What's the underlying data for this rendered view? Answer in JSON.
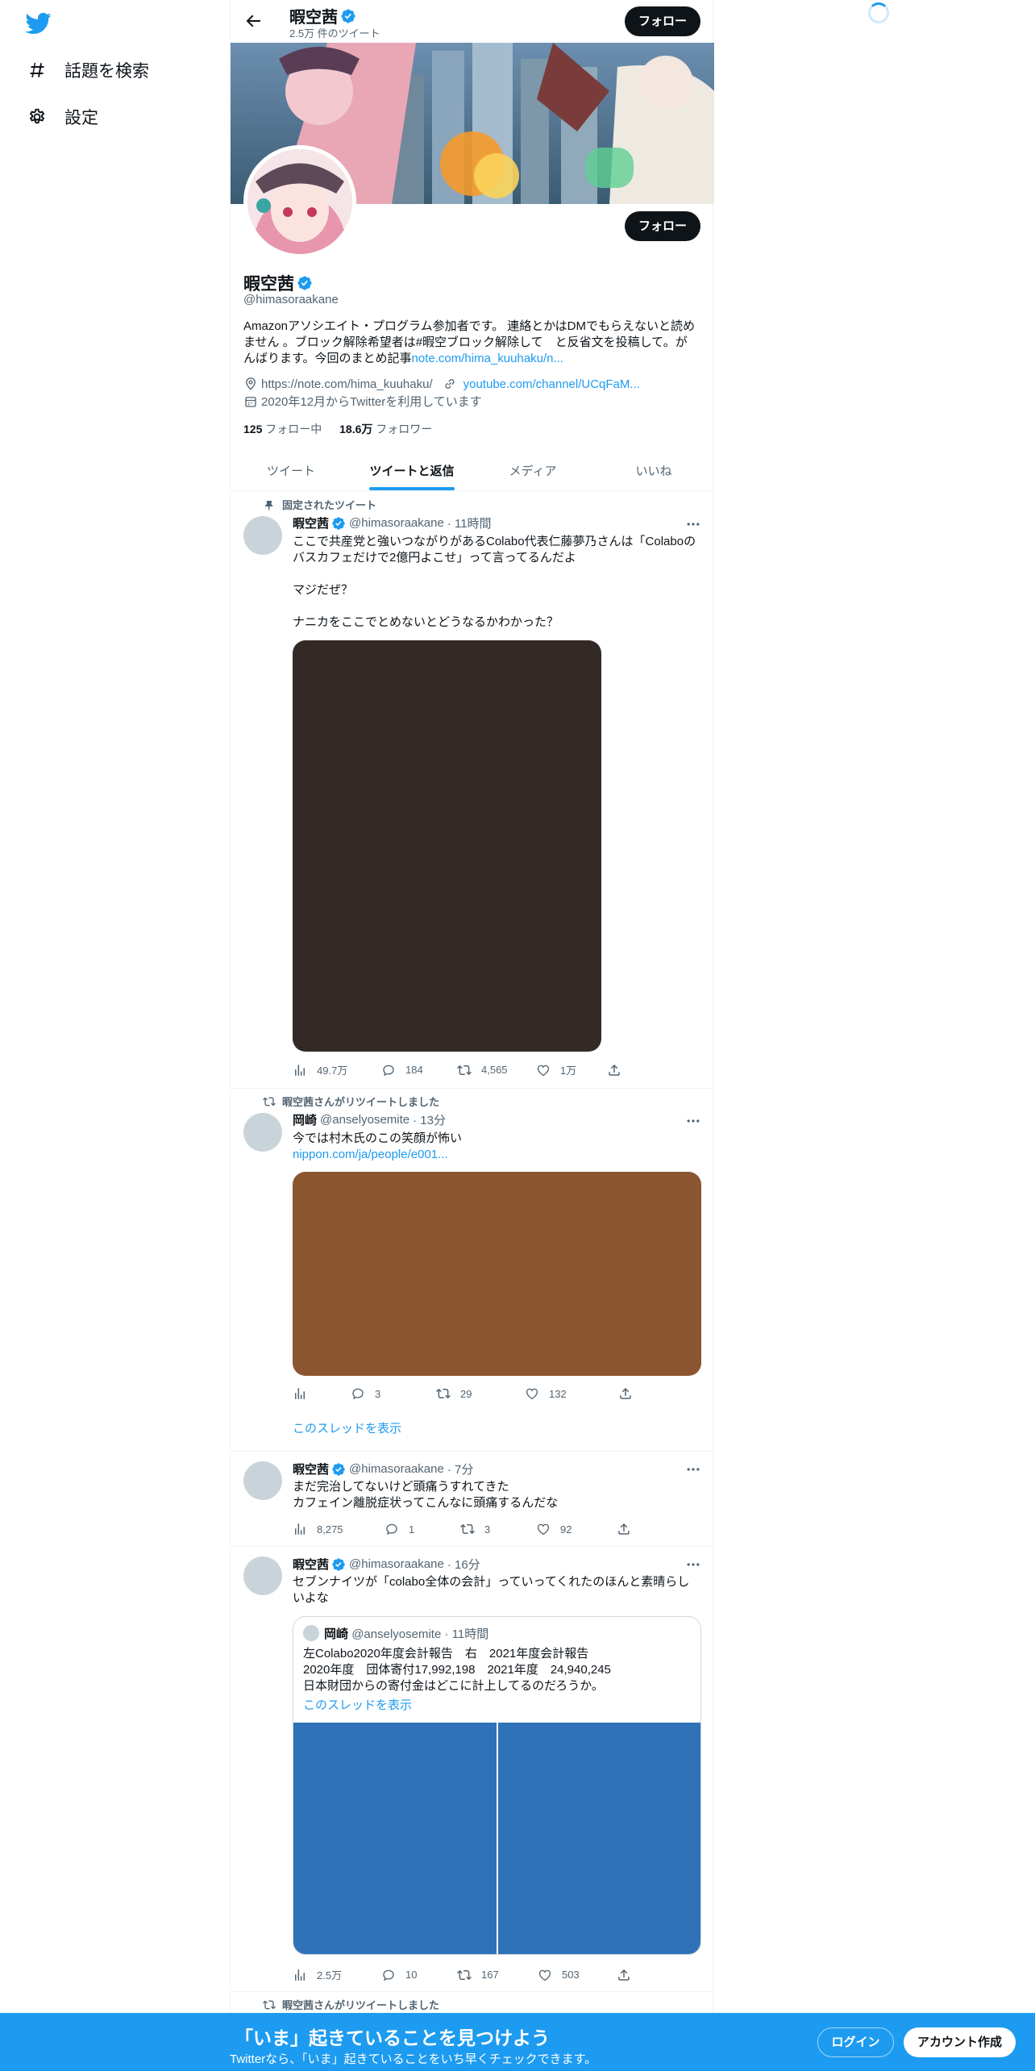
{
  "nav": {
    "explore_label": "話題を検索",
    "settings_label": "設定",
    "icons": [
      "twitter-logo",
      "hashtag-icon",
      "gear-icon"
    ]
  },
  "header": {
    "name": "暇空茜",
    "tweet_count": "2.5万 件のツイート",
    "follow_label": "フォロー"
  },
  "profile": {
    "name": "暇空茜",
    "handle": "@himasoraakane",
    "follow_label": "フォロー",
    "bio_line1": "Amazonアソシエイト・プログラム参加者です。 連絡とかはDMでもらえないと読め",
    "bio_line2": "ません 。ブロック解除希望者は#暇空ブロック解除して　と反省文を投稿して。が",
    "bio_line3": "んばります。今回のまとめ記事",
    "bio_link": "note.com/hima_kuuhaku/n...",
    "location": "https://note.com/hima_kuuhaku/",
    "website": "youtube.com/channel/UCqFaM...",
    "joined": "2020年12月からTwitterを利用しています",
    "following_count": "125",
    "following_label": "フォロー中",
    "followers_count": "18.6万",
    "followers_label": "フォロワー"
  },
  "tabs": [
    "ツイート",
    "ツイートと返信",
    "メディア",
    "いいね"
  ],
  "active_tab": "ツイートと返信",
  "tweets": [
    {
      "context": "固定されたツイート",
      "name": "暇空茜",
      "handle": "@himasoraakane",
      "time": "· 11時間",
      "text": "ここで共産党と強いつながりがあるColabo代表仁藤夢乃さんは「Colaboの\nバスカフェだけで2億円よこせ」って言ってるんだよ\n\nマジだぜ？\n\nナニカをここでとめないとどうなるかわかった？",
      "views": "49.7万",
      "replies": "184",
      "retweets": "4,565",
      "likes": "1万",
      "media_color": "#332a27"
    },
    {
      "context": "暇空茜さんがリツイートしました",
      "name": "岡崎",
      "handle": "@anselyosemite",
      "time": "· 13分",
      "text": "今では村木氏のこの笑顔が怖い",
      "link": "nippon.com/ja/people/e001...",
      "replies": "3",
      "retweets": "29",
      "likes": "132",
      "show_thread": "このスレッドを表示",
      "media_color": "#8b5530"
    },
    {
      "name": "暇空茜",
      "handle": "@himasoraakane",
      "time": "· 7分",
      "text": "まだ完治してないけど頭痛うすれてきた\nカフェイン離脱症状ってこんなに頭痛するんだな",
      "views": "8,275",
      "replies": "1",
      "retweets": "3",
      "likes": "92"
    },
    {
      "name": "暇空茜",
      "handle": "@himasoraakane",
      "time": "· 16分",
      "text": "セブンナイツが「colabo全体の会計」っていってくれたのほんと素晴らし\nいよな",
      "quote": {
        "name": "岡崎",
        "handle": "@anselyosemite",
        "time": "· 11時間",
        "text": "左Colabo2020年度会計報告　右　2021年度会計報告\n2020年度　団体寄付17,992,198　2021年度　24,940,245\n日本財団からの寄付金はどこに計上してるのだろうか。",
        "show_thread": "このスレッドを表示",
        "media_color": "#2f72b8"
      },
      "views": "2.5万",
      "replies": "10",
      "retweets": "167",
      "likes": "503"
    },
    {
      "context": "暇空茜さんがリツイートしました"
    }
  ],
  "bottom_bar": {
    "title": "「いま」起きていることを見つけよう",
    "subtitle": "Twitterなら、「いま」起きていることをいち早くチェックできます。",
    "login_label": "ログイン",
    "signup_label": "アカウント作成"
  },
  "colors": {
    "accent": "#1d9bf0",
    "text": "#0f1419",
    "muted": "#536471"
  }
}
